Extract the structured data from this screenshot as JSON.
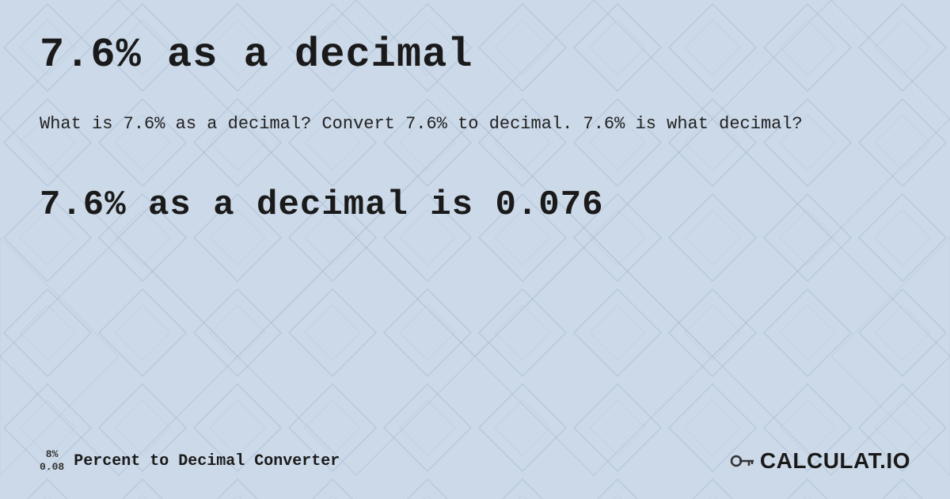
{
  "page": {
    "title": "7.6% as a decimal",
    "description": "What is 7.6% as a decimal? Convert 7.6% to decimal. 7.6% is what decimal?",
    "result": "7.6% as a decimal is 0.076",
    "footer": {
      "badge_top": "8%",
      "badge_bottom": "0.08",
      "label": "Percent to Decimal Converter",
      "logo_text": "CALCULAT.IO"
    }
  }
}
